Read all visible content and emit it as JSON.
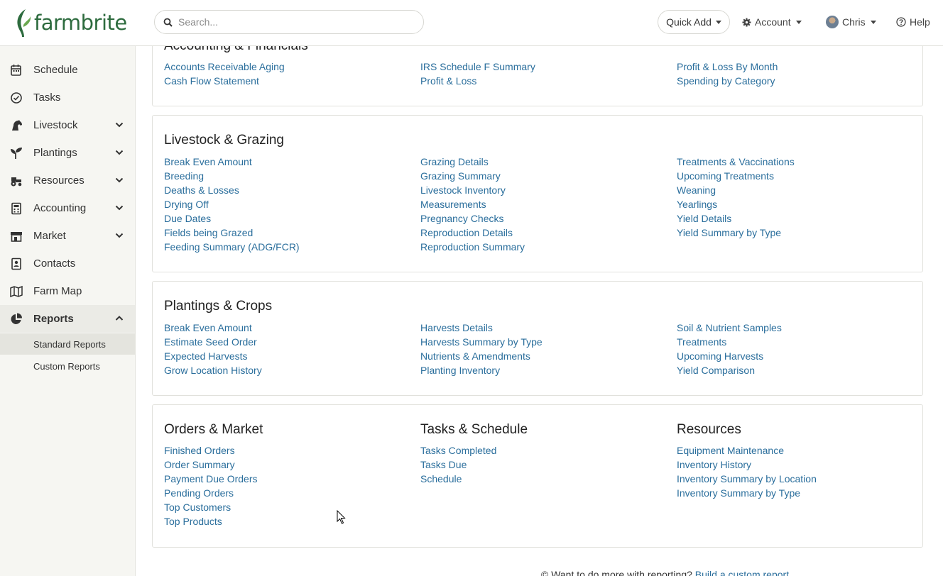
{
  "header": {
    "logo_text": "farmbrite",
    "search_placeholder": "Search...",
    "quick_add_label": "Quick Add",
    "account_label": "Account",
    "user_label": "Chris",
    "help_label": "Help"
  },
  "sidebar": {
    "items": [
      {
        "label": "Schedule",
        "icon": "calendar-icon"
      },
      {
        "label": "Tasks",
        "icon": "check-circle-icon"
      },
      {
        "label": "Livestock",
        "icon": "horse-icon"
      },
      {
        "label": "Plantings",
        "icon": "seedling-icon"
      },
      {
        "label": "Resources",
        "icon": "tractor-icon"
      },
      {
        "label": "Accounting",
        "icon": "calculator-icon"
      },
      {
        "label": "Market",
        "icon": "store-icon"
      },
      {
        "label": "Contacts",
        "icon": "address-book-icon"
      },
      {
        "label": "Farm Map",
        "icon": "map-icon"
      },
      {
        "label": "Reports",
        "icon": "pie-chart-icon"
      }
    ],
    "sub_items": [
      "Standard Reports",
      "Custom Reports"
    ]
  },
  "sections": {
    "accounting": {
      "title": "Accounting & Financials",
      "col1": [
        "Accounts Receivable Aging",
        "Cash Flow Statement"
      ],
      "col2": [
        "IRS Schedule F Summary",
        "Profit & Loss"
      ],
      "col3": [
        "Profit & Loss By Month",
        "Spending by Category"
      ]
    },
    "livestock": {
      "title": "Livestock & Grazing",
      "col1": [
        "Break Even Amount",
        "Breeding",
        "Deaths & Losses",
        "Drying Off",
        "Due Dates",
        "Fields being Grazed",
        "Feeding Summary (ADG/FCR)"
      ],
      "col2": [
        "Grazing Details",
        "Grazing Summary",
        "Livestock Inventory",
        "Measurements",
        "Pregnancy Checks",
        "Reproduction Details",
        "Reproduction Summary"
      ],
      "col3": [
        "Treatments & Vaccinations",
        "Upcoming Treatments",
        "Weaning",
        "Yearlings",
        "Yield Details",
        "Yield Summary by Type"
      ]
    },
    "plantings": {
      "title": "Plantings & Crops",
      "col1": [
        "Break Even Amount",
        "Estimate Seed Order",
        "Expected Harvests",
        "Grow Location History"
      ],
      "col2": [
        "Harvests Details",
        "Harvests Summary by Type",
        "Nutrients & Amendments",
        "Planting Inventory"
      ],
      "col3": [
        "Soil & Nutrient Samples",
        "Treatments",
        "Upcoming Harvests",
        "Yield Comparison"
      ]
    },
    "orders": {
      "title": "Orders & Market",
      "links": [
        "Finished Orders",
        "Order Summary",
        "Payment Due Orders",
        "Pending Orders",
        "Top Customers",
        "Top Products"
      ]
    },
    "tasks": {
      "title": "Tasks & Schedule",
      "links": [
        "Tasks Completed",
        "Tasks Due",
        "Schedule"
      ]
    },
    "resources": {
      "title": "Resources",
      "links": [
        "Equipment Maintenance",
        "Inventory History",
        "Inventory Summary by Location",
        "Inventory Summary by Type"
      ]
    }
  },
  "footer": {
    "text": "© Want to do more with reporting?",
    "link": "Build a custom report"
  },
  "colors": {
    "brand": "#2d6b3e",
    "link": "#2a6e9c",
    "sidebar_bg": "#f6f6f2"
  }
}
